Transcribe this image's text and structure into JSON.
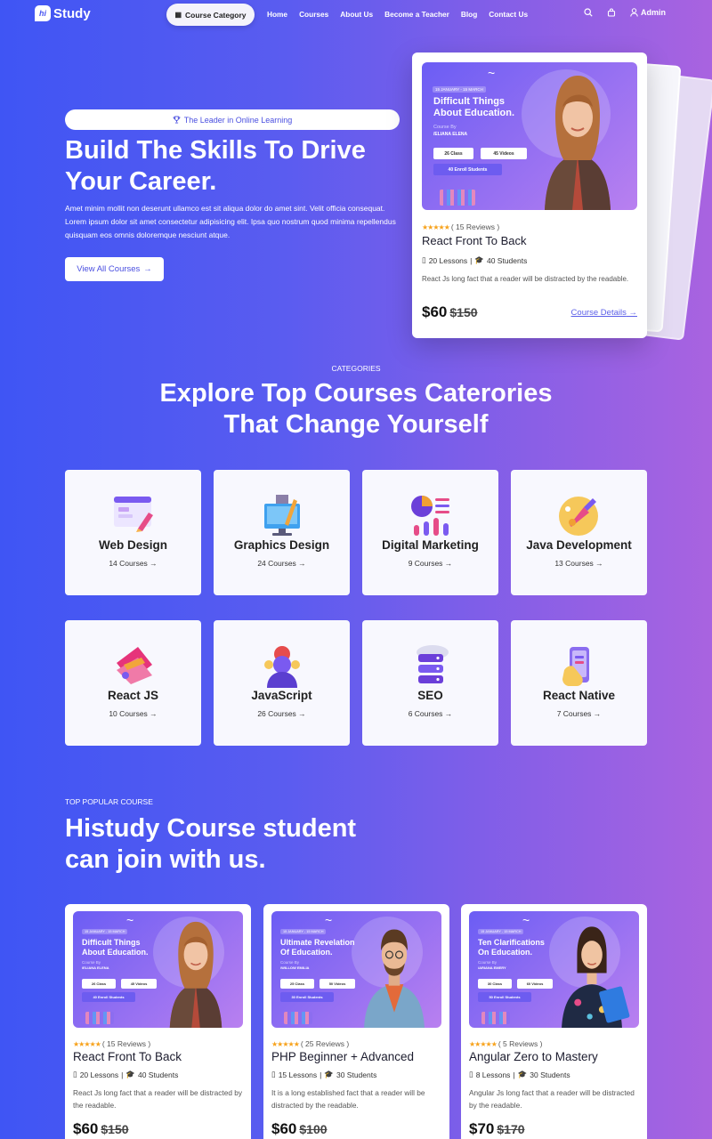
{
  "nav": {
    "logo_mark": "hi",
    "logo_text": "Study",
    "category_button": "Course Category",
    "menu": [
      "Home",
      "Courses",
      "About Us",
      "Become a Teacher",
      "Blog",
      "Contact Us"
    ],
    "user": "Admin"
  },
  "hero": {
    "tagline": "The Leader in Online Learning",
    "title_line1": "Build The Skills To Drive",
    "title_line2": "Your Career.",
    "description": "Amet minim mollit non deserunt ullamco est sit aliqua dolor do amet sint. Velit officia consequat. Lorem ipsum dolor sit amet consectetur adipisicing elit. Ipsa quo nostrum quod minima repellendus quisquam eos omnis doloremque nesciunt atque.",
    "button": "View All Courses"
  },
  "featured": {
    "banner_date": "15 JANUARY - 15 MARCH",
    "banner_title_1": "Difficult Things",
    "banner_title_2": "About Education.",
    "banner_by": "Course By",
    "banner_author": "/ELIANA ELENA",
    "banner_class": "26 Class",
    "banner_videos": "45 Videos",
    "banner_enroll": "40 Enroll Students",
    "stars": "★★★★★",
    "reviews": "( 15 Reviews )",
    "title": "React Front To Back",
    "lessons": "20 Lessons",
    "students": "40 Students",
    "description": "React Js long fact that a reader will be distracted by the readable.",
    "price": "$60",
    "old_price": "$150",
    "details": "Course Details"
  },
  "categories": {
    "label": "CATEGORIES",
    "title_line1": "Explore Top Courses Caterories",
    "title_line2": "That Change Yourself",
    "items": [
      {
        "name": "Web Design",
        "count": "14 Courses",
        "icon": "web-design-icon"
      },
      {
        "name": "Graphics Design",
        "count": "24 Courses",
        "icon": "graphics-design-icon"
      },
      {
        "name": "Digital Marketing",
        "count": "9 Courses",
        "icon": "digital-marketing-icon"
      },
      {
        "name": "Java Development",
        "count": "13 Courses",
        "icon": "java-development-icon"
      },
      {
        "name": "React JS",
        "count": "10 Courses",
        "icon": "react-js-icon"
      },
      {
        "name": "JavaScript",
        "count": "26 Courses",
        "icon": "javascript-icon"
      },
      {
        "name": "SEO",
        "count": "6 Courses",
        "icon": "seo-icon"
      },
      {
        "name": "React Native",
        "count": "7 Courses",
        "icon": "react-native-icon"
      }
    ]
  },
  "popular": {
    "label": "TOP POPULAR COURSE",
    "title_line1": "Histudy Course student",
    "title_line2": "can join with us.",
    "courses": [
      {
        "banner_date": "15 JANUARY - 15 MARCH",
        "banner_title_1": "Difficult Things",
        "banner_title_2": "About Education.",
        "banner_by": "Course By",
        "banner_author": "/ELIANA ELENA",
        "banner_class": "26 Class",
        "banner_videos": "45 Videos",
        "banner_enroll": "40 Enroll Students",
        "stars": "★★★★★",
        "reviews": "( 15 Reviews )",
        "title": "React Front To Back",
        "lessons": "20 Lessons",
        "students": "40 Students",
        "description": "React Js long fact that a reader will be distracted by the readable.",
        "price": "$60",
        "old_price": "$150"
      },
      {
        "banner_date": "15 JANUARY - 15 MARCH",
        "banner_title_1": "Ultimate Revelation",
        "banner_title_2": "Of Education.",
        "banner_by": "Course By",
        "banner_author": "/WILLOW EMILIA",
        "banner_class": "25 Class",
        "banner_videos": "50 Videos",
        "banner_enroll": "30 Enroll Students",
        "stars": "★★★★★",
        "reviews": "( 25 Reviews )",
        "title": "PHP Beginner + Advanced",
        "lessons": "15 Lessons",
        "students": "30 Students",
        "description": "It is a long established fact that a reader will be distracted by the readable.",
        "price": "$60",
        "old_price": "$100"
      },
      {
        "banner_date": "15 JANUARY - 15 MARCH",
        "banner_title_1": "Ten Clarifications",
        "banner_title_2": "On Education.",
        "banner_by": "Course By",
        "banner_author": "/ARIANA EMERY",
        "banner_class": "30 Class",
        "banner_videos": "60 Videos",
        "banner_enroll": "50 Enroll Students",
        "stars": "★★★★★",
        "reviews": "( 5 Reviews )",
        "title": "Angular Zero to Mastery",
        "lessons": "8 Lessons",
        "students": "30 Students",
        "description": "Angular Js long fact that a reader will be distracted by the readable.",
        "price": "$70",
        "old_price": "$170"
      }
    ]
  }
}
